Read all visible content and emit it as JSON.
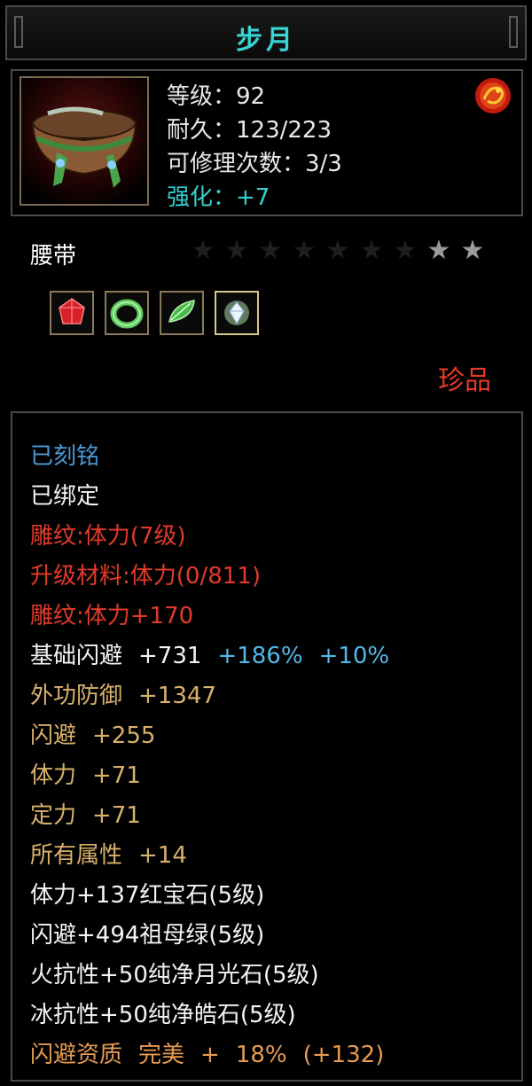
{
  "title": "步月",
  "item": {
    "stats": [
      {
        "text": "等级：92",
        "color": "white"
      },
      {
        "text": "耐久：123/223",
        "color": "white"
      },
      {
        "text": "可修理次数：3/3",
        "color": "white"
      },
      {
        "text": "强化：+7",
        "color": "cyan"
      }
    ],
    "type": "腰带",
    "stars_total": 9,
    "stars_filled": 2,
    "gems": [
      "ruby-gem-icon",
      "emerald-ring-gem-icon",
      "jade-gem-icon",
      "diamond-gem-icon"
    ],
    "rarity": "珍品"
  },
  "attributes": [
    {
      "parts": [
        "已刻铭"
      ],
      "color": "blue"
    },
    {
      "parts": [
        "已绑定"
      ],
      "color": "white"
    },
    {
      "parts": [
        "雕纹:体力(7级)"
      ],
      "color": "red"
    },
    {
      "parts": [
        "升级材料:体力(0/811)"
      ],
      "color": "red"
    },
    {
      "parts": [
        "雕纹:体力+170"
      ],
      "color": "red"
    },
    {
      "parts": [
        "基础闪避",
        "+731"
      ],
      "extra": [
        "+186%",
        "+10%"
      ],
      "color": "white"
    },
    {
      "parts": [
        "外功防御",
        "+1347"
      ],
      "color": "gold"
    },
    {
      "parts": [
        "闪避",
        "+255"
      ],
      "color": "gold"
    },
    {
      "parts": [
        "体力",
        "+71"
      ],
      "color": "gold"
    },
    {
      "parts": [
        "定力",
        "+71"
      ],
      "color": "gold"
    },
    {
      "parts": [
        "所有属性",
        "+14"
      ],
      "color": "gold"
    },
    {
      "parts": [
        "体力+137红宝石(5级)"
      ],
      "color": "white"
    },
    {
      "parts": [
        "闪避+494祖母绿(5级)"
      ],
      "color": "white"
    },
    {
      "parts": [
        "火抗性+50纯净月光石(5级)"
      ],
      "color": "white"
    },
    {
      "parts": [
        "冰抗性+50纯净皓石(5级)"
      ],
      "color": "white"
    },
    {
      "parts": [
        "闪避资质",
        "完美",
        "+",
        "18%",
        "(+132)"
      ],
      "color": "orange"
    }
  ]
}
